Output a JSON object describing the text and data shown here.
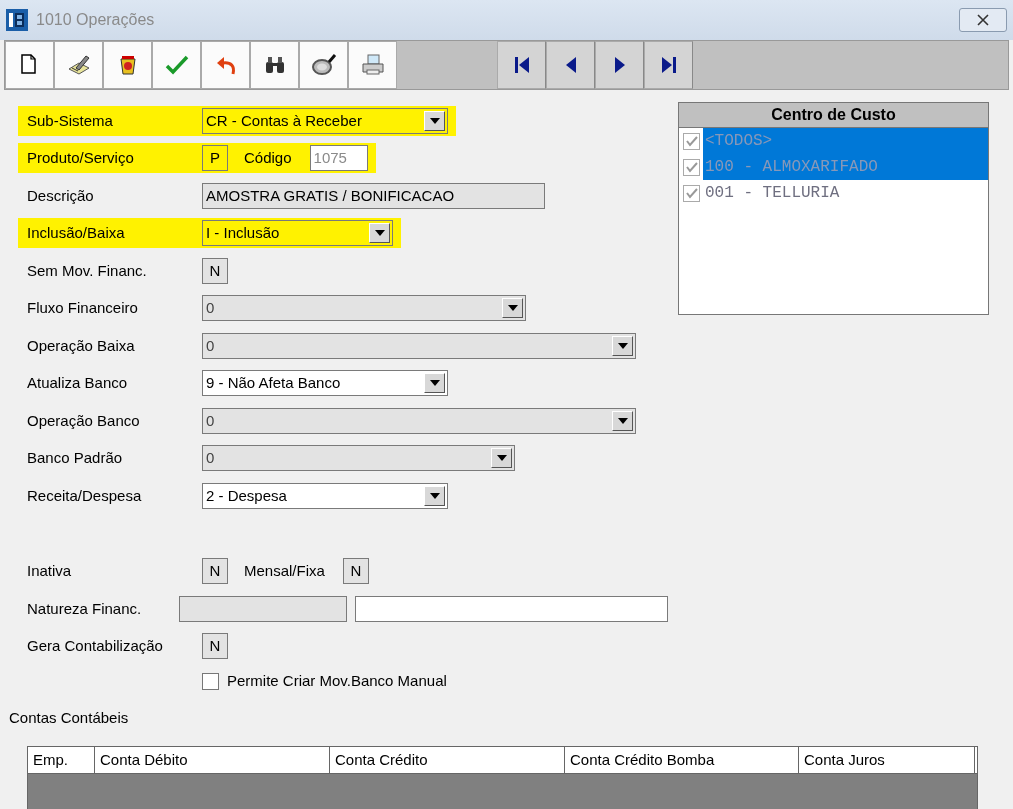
{
  "window": {
    "title": "1010 Operações"
  },
  "form": {
    "rows": [
      {
        "label": "Sub-Sistema",
        "highlighted": true,
        "controls": [
          {
            "kind": "combo",
            "value": "CR - Contas à Receber",
            "enabled": true,
            "highlighted": true
          }
        ]
      },
      {
        "label": "Produto/Serviço",
        "highlighted": true,
        "controls": [
          {
            "kind": "box",
            "value": "P",
            "highlighted": true
          },
          {
            "kind": "caption",
            "value": "Código"
          },
          {
            "kind": "text",
            "value": "1075",
            "enabled": true,
            "readonly": true
          }
        ]
      },
      {
        "label": "Descrição",
        "highlighted": false,
        "controls": [
          {
            "kind": "text",
            "value": "AMOSTRA GRATIS / BONIFICACAO",
            "enabled": false,
            "readonly": false
          }
        ]
      },
      {
        "label": "Inclusão/Baixa",
        "highlighted": true,
        "controls": [
          {
            "kind": "combo",
            "value": "I - Inclusão",
            "enabled": true,
            "highlighted": true
          }
        ]
      },
      {
        "label": "Sem Mov. Financ.",
        "highlighted": false,
        "controls": [
          {
            "kind": "box",
            "value": "N",
            "highlighted": false
          }
        ]
      },
      {
        "label": "Fluxo Financeiro",
        "highlighted": false,
        "controls": [
          {
            "kind": "combo",
            "value": "0",
            "enabled": false,
            "highlighted": false
          }
        ]
      },
      {
        "label": "Operação Baixa",
        "highlighted": false,
        "controls": [
          {
            "kind": "combo",
            "value": "0",
            "enabled": false,
            "highlighted": false
          }
        ]
      },
      {
        "label": "Atualiza Banco",
        "highlighted": false,
        "controls": [
          {
            "kind": "combo",
            "value": "9 - Não Afeta Banco",
            "enabled": true,
            "highlighted": false
          }
        ]
      },
      {
        "label": "Operação Banco",
        "highlighted": false,
        "controls": [
          {
            "kind": "combo",
            "value": "0",
            "enabled": false,
            "highlighted": false
          }
        ]
      },
      {
        "label": "Banco Padrão",
        "highlighted": false,
        "controls": [
          {
            "kind": "combo",
            "value": "0",
            "enabled": false,
            "highlighted": false
          }
        ]
      },
      {
        "label": "Receita/Despesa",
        "highlighted": false,
        "controls": [
          {
            "kind": "combo",
            "value": "2 - Despesa",
            "enabled": true,
            "highlighted": false
          }
        ]
      }
    ],
    "flags": [
      {
        "label": "Inativa",
        "controls": [
          {
            "kind": "box",
            "value": "N",
            "highlighted": false
          },
          {
            "kind": "caption",
            "value": "Mensal/Fixa"
          },
          {
            "kind": "box",
            "value": "N",
            "highlighted": false
          }
        ]
      },
      {
        "label": "Natureza Financ.",
        "controls": [
          {
            "kind": "text",
            "enabled": false
          },
          {
            "kind": "text",
            "enabled": true
          }
        ]
      },
      {
        "label": "Gera Contabilização",
        "controls": [
          {
            "kind": "box",
            "value": "N",
            "highlighted": false
          }
        ]
      },
      {
        "controls": [
          {
            "kind": "checkbox",
            "value": "Permite Criar Mov.Banco Manual",
            "checked": false
          }
        ]
      }
    ]
  },
  "cost_center": {
    "title": "Centro de Custo",
    "items": [
      {
        "label": "<TODOS>",
        "checked": true,
        "selected": true
      },
      {
        "label": "100 - ALMOXARIFADO",
        "checked": true,
        "selected": true
      },
      {
        "label": "001 - TELLURIA",
        "checked": true,
        "selected": false
      }
    ]
  },
  "accounts": {
    "title": "Contas Contábeis",
    "columns": [
      "Emp.",
      "Conta Débito",
      "Conta Crédito",
      "Conta Crédito Bomba",
      "Conta Juros"
    ]
  }
}
